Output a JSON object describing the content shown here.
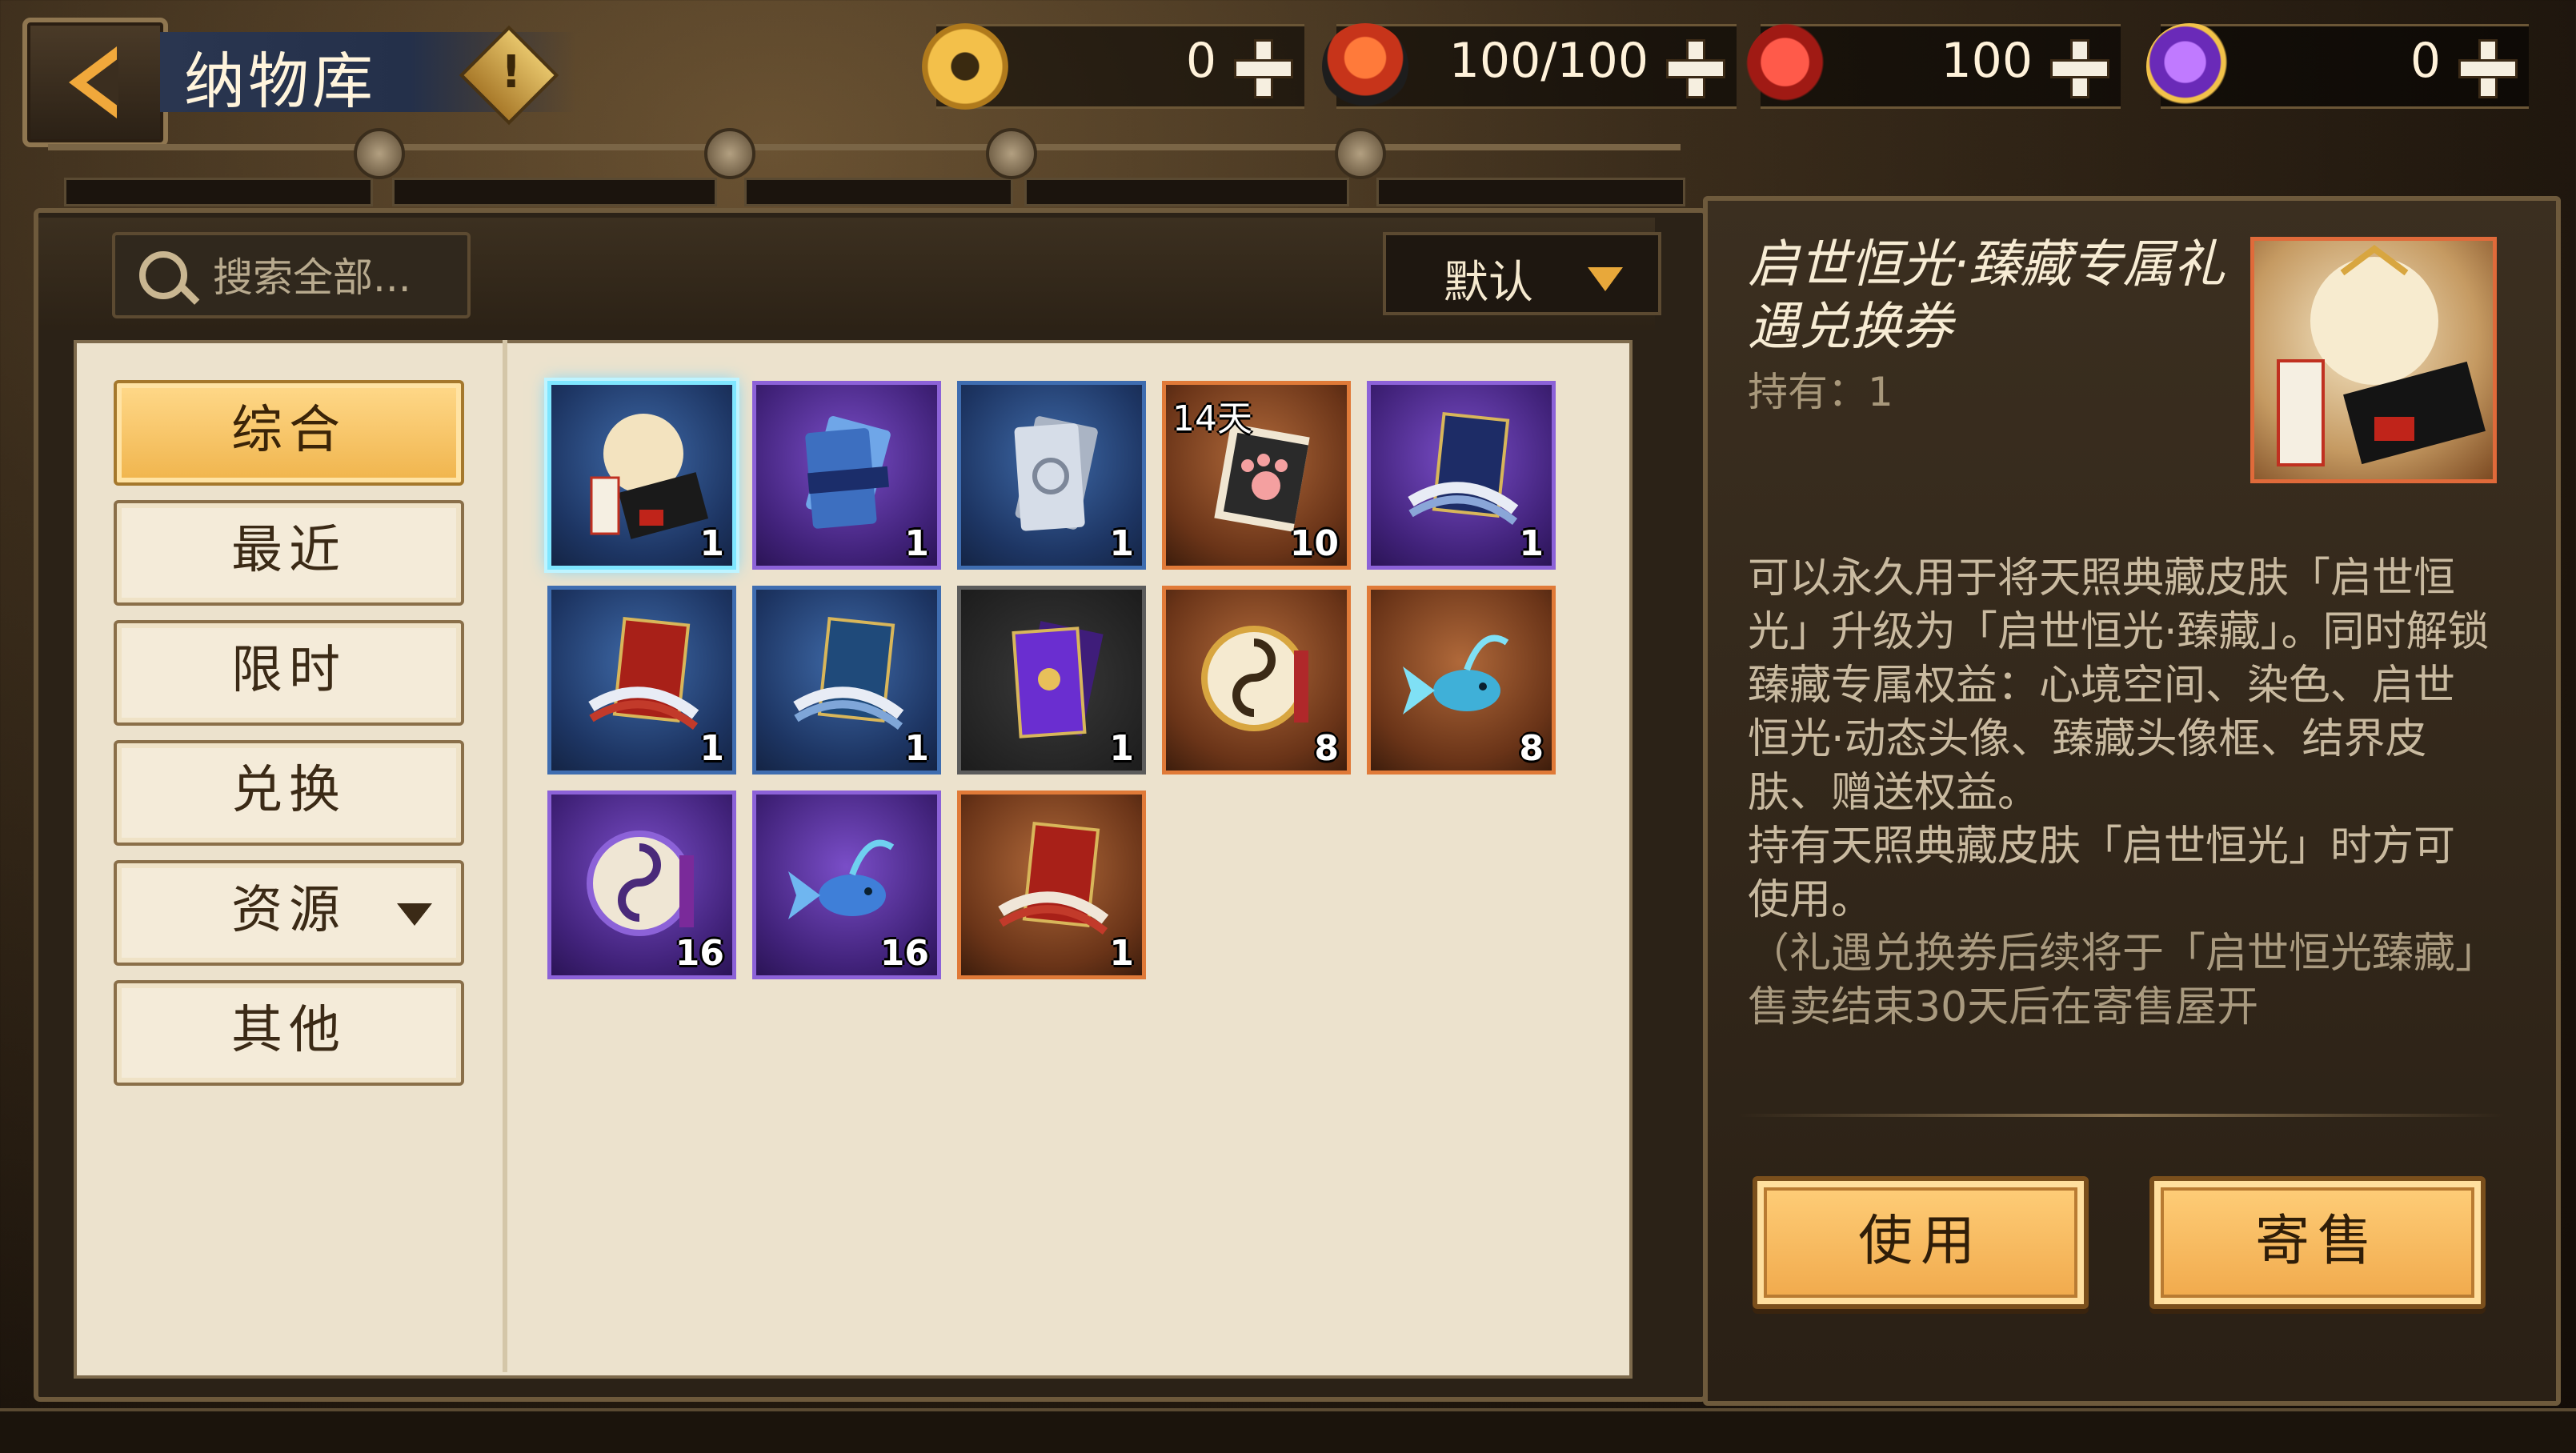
{
  "header": {
    "title": "纳物库",
    "info_icon": "!"
  },
  "resources": [
    {
      "name": "gold-coin",
      "value": "0"
    },
    {
      "name": "stamina-sushi",
      "value": "100/100"
    },
    {
      "name": "red-magatama",
      "value": "100"
    },
    {
      "name": "purple-magatama",
      "value": "0"
    }
  ],
  "search": {
    "placeholder": "搜索全部..."
  },
  "sort": {
    "selected": "默认"
  },
  "sidebar": {
    "items": [
      {
        "label": "综合",
        "active": true
      },
      {
        "label": "最近"
      },
      {
        "label": "限时"
      },
      {
        "label": "兑换"
      },
      {
        "label": "资源",
        "has_dropdown": true
      },
      {
        "label": "其他"
      }
    ]
  },
  "items": [
    {
      "icon": "qishi-hengguang-voucher",
      "rarity": "blue",
      "qty": "1",
      "selected": true
    },
    {
      "icon": "blue-ticket-bundle",
      "rarity": "purple",
      "qty": "1"
    },
    {
      "icon": "silver-ticket",
      "rarity": "blue",
      "qty": "1"
    },
    {
      "icon": "paw-scroll",
      "rarity": "orange",
      "qty": "10",
      "tag": "14天"
    },
    {
      "icon": "hyakki-ticket",
      "rarity": "purple",
      "qty": "1"
    },
    {
      "icon": "challenge-ticket",
      "rarity": "blue",
      "qty": "1"
    },
    {
      "icon": "breakthrough-ticket",
      "rarity": "blue",
      "qty": "1"
    },
    {
      "icon": "purple-flower-ticket",
      "rarity": "purple",
      "qty": "1"
    },
    {
      "icon": "gold-drum",
      "rarity": "orange",
      "qty": "8"
    },
    {
      "icon": "gold-fish",
      "rarity": "orange",
      "qty": "8"
    },
    {
      "icon": "purple-drum",
      "rarity": "purple",
      "qty": "16"
    },
    {
      "icon": "purple-fish",
      "rarity": "purple",
      "qty": "16"
    },
    {
      "icon": "skin-ticket",
      "rarity": "orange",
      "qty": "1"
    }
  ],
  "detail": {
    "title": "启世恒光·臻藏专属礼遇兑换券",
    "owned": "持有：1",
    "description": "可以永久用于将天照典藏皮肤「启世恒光」升级为「启世恒光·臻藏」。同时解锁臻藏专属权益：心境空间、染色、启世恒光·动态头像、臻藏头像框、结界皮肤、赠送权益。",
    "usage": "持有天照典藏皮肤「启世恒光」时方可使用。",
    "note": "（礼遇兑换券后续将于「启世恒光臻藏」售卖结束30天后在寄售屋开",
    "use_label": "使用",
    "consign_label": "寄售"
  },
  "colors": {
    "accent": "#f0b44c",
    "selected_border": "#7fe6ff",
    "rarity_orange": "#e07a38",
    "rarity_purple": "#8c62d8",
    "rarity_blue": "#3f6db0"
  }
}
